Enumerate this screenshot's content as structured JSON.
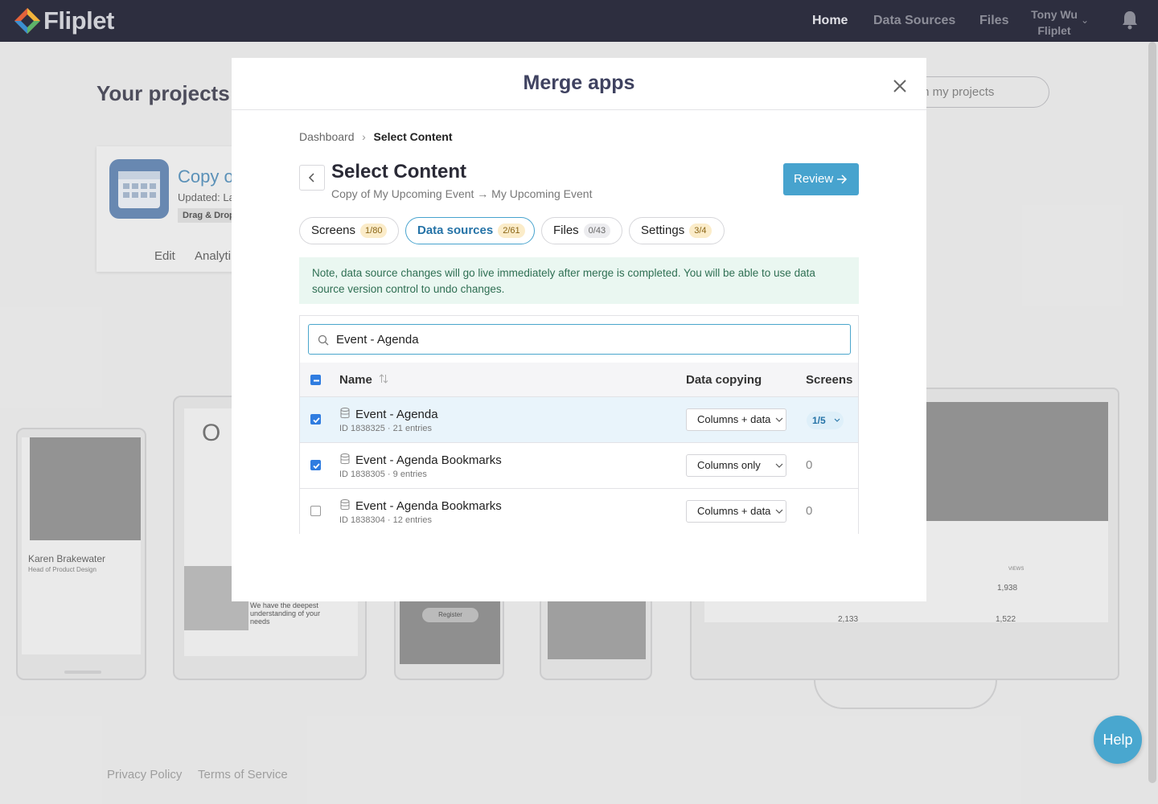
{
  "topbar": {
    "logo_text": "Fliplet",
    "nav": [
      "Home",
      "Data Sources",
      "Files"
    ],
    "user_name": "Tony Wu",
    "user_org": "Fliplet"
  },
  "background": {
    "page_title": "Your projects",
    "search_placeholder": "th my projects",
    "card": {
      "app_name": "Copy of",
      "updated": "Updated: La",
      "tag": "Drag & Drop",
      "edit": "Edit",
      "analytics": "Analyti"
    },
    "previews": {
      "profile_name": "Karen Brakewater",
      "profile_role": "Head of Product Design",
      "hero_text": "We have the deepest understanding of your needs",
      "register": "Register",
      "views_header": "VIEWS",
      "views_1": "1,938",
      "views_2": "2,133",
      "views_3": "1,522"
    },
    "footer": [
      "Privacy Policy",
      "Terms of Service"
    ]
  },
  "help_label": "Help",
  "modal": {
    "title": "Merge apps",
    "breadcrumb": [
      "Dashboard",
      "Select Content"
    ],
    "heading": "Select Content",
    "subheading": "Copy of My Upcoming Event → My Upcoming Event",
    "review_label": "Review",
    "tabs": [
      {
        "label": "Screens",
        "badge": "1/80"
      },
      {
        "label": "Data sources",
        "badge": "2/61"
      },
      {
        "label": "Files",
        "badge": "0/43"
      },
      {
        "label": "Settings",
        "badge": "3/4"
      }
    ],
    "note": "Note, data source changes will go live immediately after merge is completed. You will be able to use data source version control to undo changes.",
    "search_value": "Event - Agenda",
    "columns": {
      "name": "Name",
      "copying": "Data copying",
      "screens": "Screens"
    },
    "rows": [
      {
        "name": "Event - Agenda",
        "meta": "ID 1838325 · 21 entries",
        "copying": "Columns + data",
        "screens": "1/5",
        "checked": true
      },
      {
        "name": "Event - Agenda Bookmarks",
        "meta": "ID 1838305 · 9 entries",
        "copying": "Columns only",
        "screens": "0",
        "checked": true
      },
      {
        "name": "Event - Agenda Bookmarks",
        "meta": "ID 1838304 · 12 entries",
        "copying": "Columns + data",
        "screens": "0",
        "checked": false
      }
    ]
  },
  "colors": {
    "topbar": "#2d2e3f",
    "accent": "#47a3ce",
    "checkbox": "#2f7ce0",
    "note_bg": "#eaf7f1"
  }
}
